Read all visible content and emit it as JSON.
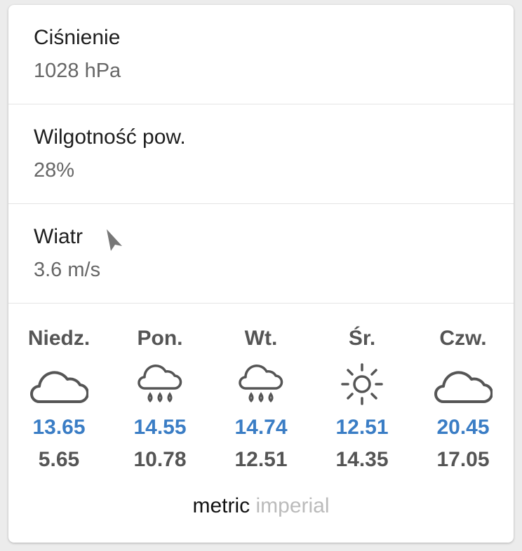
{
  "pressure": {
    "label": "Ciśnienie",
    "value": "1028 hPa"
  },
  "humidity": {
    "label": "Wilgotność pow.",
    "value": "28%"
  },
  "wind": {
    "label": "Wiatr",
    "value": "3.6 m/s",
    "direction_icon": "navigation-arrow-icon"
  },
  "forecast": [
    {
      "day": "Niedz.",
      "icon": "cloud-icon",
      "high": "13.65",
      "low": "5.65"
    },
    {
      "day": "Pon.",
      "icon": "rain-icon",
      "high": "14.55",
      "low": "10.78"
    },
    {
      "day": "Wt.",
      "icon": "rain-icon",
      "high": "14.74",
      "low": "12.51"
    },
    {
      "day": "Śr.",
      "icon": "sun-icon",
      "high": "12.51",
      "low": "14.35"
    },
    {
      "day": "Czw.",
      "icon": "cloud-icon",
      "high": "20.45",
      "low": "17.05"
    }
  ],
  "units": {
    "metric": "metric",
    "imperial": "imperial",
    "selected": "metric"
  },
  "colors": {
    "high_temp": "#3a7dc5",
    "low_temp": "#555555",
    "inactive_unit": "#bbbbbb"
  }
}
